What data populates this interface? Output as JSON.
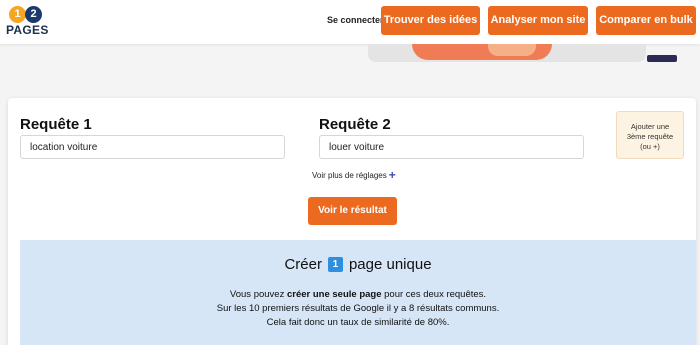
{
  "header": {
    "logo_num1": "1",
    "logo_num2": "2",
    "logo_text": "PAGES",
    "login": "Se connecter",
    "buttons": [
      "Trouver des idées",
      "Analyser mon site",
      "Comparer en bulk"
    ]
  },
  "form": {
    "query1_label": "Requête 1",
    "query1_value": "location voiture",
    "query2_label": "Requête 2",
    "query2_value": "louer voiture",
    "add_query": [
      "Ajouter une",
      "3ème requête",
      "(ou +)"
    ],
    "settings_link": "Voir plus de réglages",
    "settings_plus": "+",
    "submit": "Voir le résultat"
  },
  "result": {
    "title_prefix": "Créer",
    "title_number": "1",
    "title_suffix": "page unique",
    "line1_before": "Vous pouvez ",
    "line1_bold": "créer une seule page",
    "line1_after": " pour ces deux requêtes.",
    "line2": "Sur les 10 premiers résultats de Google il y a 8 résultats communs.",
    "line3": "Cela fait donc un taux de similarité de 80%."
  },
  "colors": {
    "accent": "#ec6a1f",
    "panel": "#d7e6f7",
    "badge": "#2f8fdf"
  }
}
